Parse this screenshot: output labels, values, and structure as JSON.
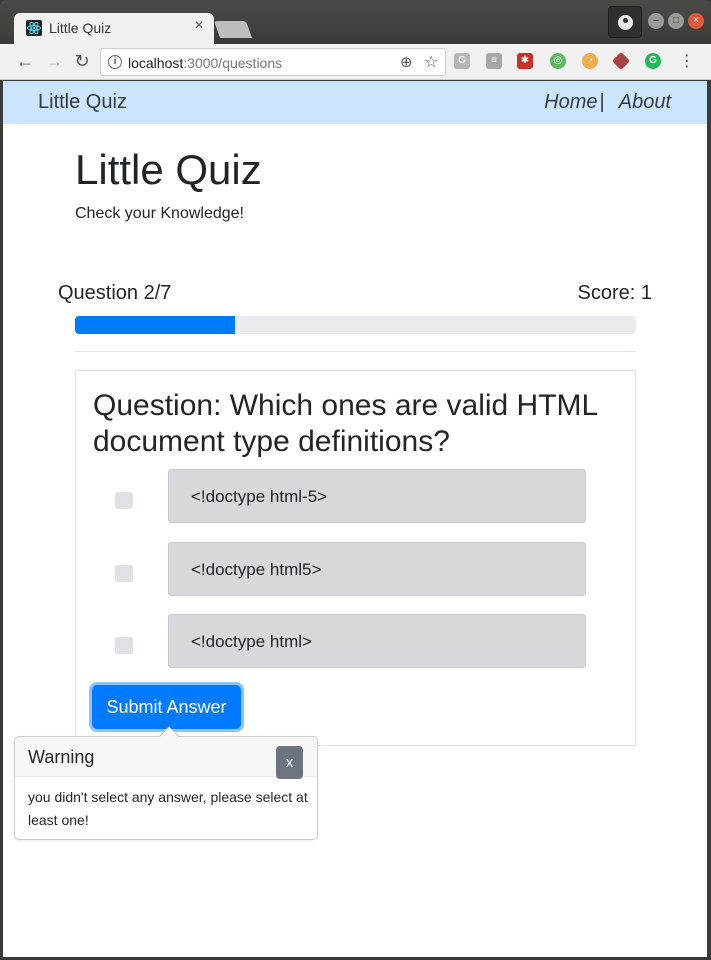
{
  "browser": {
    "tab_title": "Little Quiz",
    "tab_close": "×",
    "url_host": "localhost",
    "url_path": ":3000/questions"
  },
  "app": {
    "brand": "Little Quiz",
    "nav": {
      "home": "Home",
      "separator": "|",
      "about": "About"
    }
  },
  "jumbotron": {
    "title": "Little Quiz",
    "subtitle": "Check your Knowledge!"
  },
  "quiz": {
    "question_counter": "Question 2/7",
    "score": "Score: 1",
    "progress_fraction": 0.2857,
    "question": "Question: Which ones are valid HTML document type definitions?",
    "options": [
      {
        "label": "<!doctype html-5>",
        "checked": false
      },
      {
        "label": "<!doctype html5>",
        "checked": false
      },
      {
        "label": "<!doctype html>",
        "checked": false
      }
    ],
    "submit_label": "Submit Answer"
  },
  "popover": {
    "title": "Warning",
    "close_label": "x",
    "body": "you didn't select any answer, please select at least one!"
  },
  "colors": {
    "navbar_bg": "#cce5ff",
    "primary": "#007bff",
    "option_bg": "#d6d8db",
    "close_btn": "#6c757d"
  }
}
